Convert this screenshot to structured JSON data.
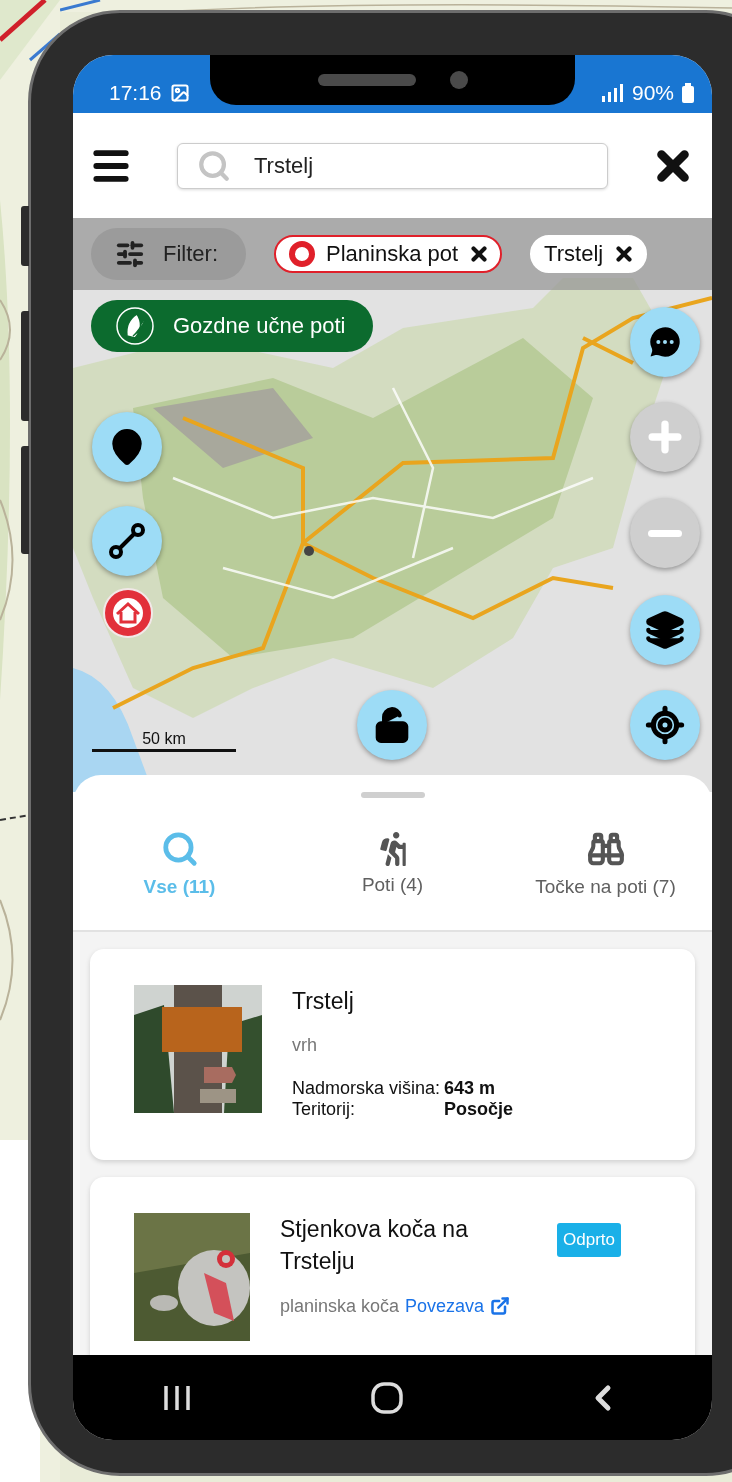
{
  "status_bar": {
    "time": "17:16",
    "battery": "90%"
  },
  "search": {
    "value": "Trstelj"
  },
  "filter": {
    "label": "Filter:",
    "chips": [
      {
        "label": "Planinska pot",
        "kind": "trail"
      },
      {
        "label": "Trstelj",
        "kind": "plain"
      }
    ]
  },
  "map": {
    "layer_button": "Gozdne učne poti",
    "scale": "50 km"
  },
  "tabs": [
    {
      "label": "Vse (11)",
      "selected": true,
      "kind": "search"
    },
    {
      "label": "Poti (4)",
      "selected": false,
      "kind": "hiker"
    },
    {
      "label": "Točke na poti (7)",
      "selected": false,
      "kind": "binoculars"
    }
  ],
  "results": [
    {
      "kind": "peak",
      "title": "Trstelj",
      "type": "vrh",
      "details": [
        {
          "label": "Nadmorska višina:",
          "value": "643 m"
        },
        {
          "label": "Teritorij:",
          "value": "Posočje"
        }
      ]
    },
    {
      "kind": "hut",
      "title": "Stjenkova koča na Trstelju",
      "type": "planinska koča",
      "link": "Povezava",
      "badge": "Odprto"
    }
  ]
}
